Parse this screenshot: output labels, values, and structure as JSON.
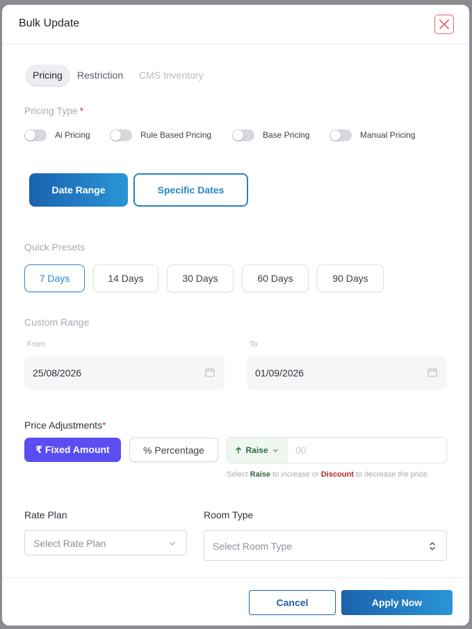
{
  "modal": {
    "title": "Bulk Update"
  },
  "tabs": [
    {
      "label": "Pricing",
      "state": "active"
    },
    {
      "label": "Restriction",
      "state": "normal"
    },
    {
      "label": "CMS Inventory",
      "state": "disabled"
    }
  ],
  "pricing_type": {
    "label": "Pricing Type",
    "required_mark": "*",
    "options": [
      {
        "label": "Ai Pricing",
        "on": false
      },
      {
        "label": "Rule Based Pricing",
        "on": false
      },
      {
        "label": "Base Pricing",
        "on": false
      },
      {
        "label": "Manual Pricing",
        "on": false
      }
    ]
  },
  "date_mode": {
    "primary": "Date Range",
    "secondary": "Specific Dates",
    "selected": "Date Range"
  },
  "quick_presets": {
    "label": "Quick Presets",
    "items": [
      "7 Days",
      "14 Days",
      "30 Days",
      "60 Days",
      "90 Days"
    ],
    "selected": "7 Days"
  },
  "custom_range": {
    "label": "Custom Range",
    "from_label": "From",
    "from_value": "25/08/2026",
    "to_label": "To",
    "to_value": "01/09/2026"
  },
  "price_adjustments": {
    "label": "Price Adjustments",
    "required_mark": "*",
    "fixed_label": "₹ Fixed Amount",
    "percentage_label": "% Percentage",
    "selected": "₹ Fixed Amount",
    "direction_label": "Raise",
    "amount_value": "",
    "amount_placeholder": "00",
    "helper_prefix": "Select ",
    "helper_raise": "Raise",
    "helper_mid": " to increase or ",
    "helper_discount": "Discount",
    "helper_suffix": " to decrease the price."
  },
  "rate_plan": {
    "label": "Rate Plan",
    "placeholder": "Select Rate Plan"
  },
  "room_type": {
    "label": "Room Type",
    "placeholder": "Select Room Type"
  },
  "footer": {
    "cancel_label": "Cancel",
    "apply_label": "Apply Now"
  },
  "colors": {
    "accent_blue": "#2186c8",
    "fixed_amount_purple": "#5a4df2",
    "raise_green": "#2f6b3d",
    "discount_red": "#b32328",
    "close_red": "#e0646b"
  }
}
